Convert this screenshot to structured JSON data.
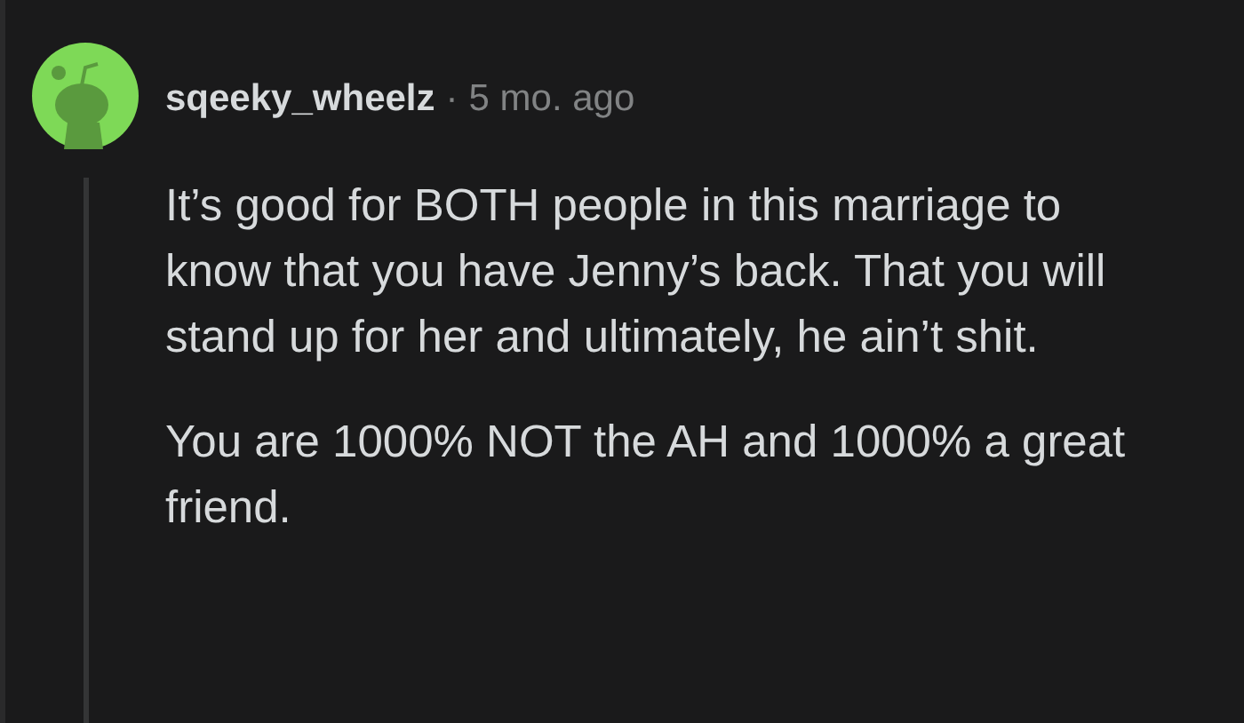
{
  "comment": {
    "username": "sqeeky_wheelz",
    "separator": "·",
    "time": "5 mo. ago",
    "paragraphs": [
      "It’s good for BOTH people in this marriage to know that you have Jenny’s back. That you will stand up for her and ultimately, he ain’t shit.",
      "You are 1000% NOT the AH and 1000% a great friend."
    ]
  }
}
